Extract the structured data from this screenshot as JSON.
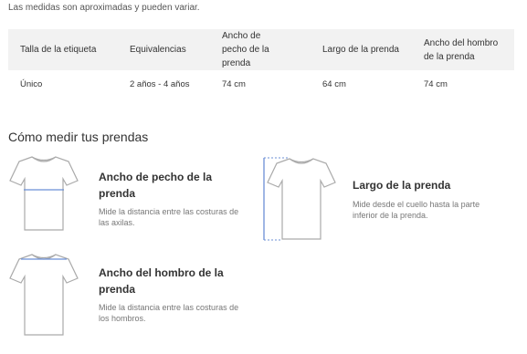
{
  "note": "Las medidas son aproximadas y pueden variar.",
  "table": {
    "headers": [
      "Talla de la etiqueta",
      "Equivalencias",
      "Ancho de pecho de la prenda",
      "Largo de la prenda",
      "Ancho del hombro de la prenda"
    ],
    "rows": [
      [
        "Único",
        "2 años - 4 años",
        "74 cm",
        "64 cm",
        "74 cm"
      ]
    ]
  },
  "how_to_measure": {
    "title": "Cómo medir tus prendas",
    "items": [
      {
        "title": "Ancho de pecho de la prenda",
        "description": "Mide la distancia entre las costuras de las axilas.",
        "icon": "shirt-chest-icon"
      },
      {
        "title": "Largo de la prenda",
        "description": "Mide desde el cuello hasta la parte inferior de la prenda.",
        "icon": "shirt-length-icon"
      },
      {
        "title": "Ancho del hombro de la prenda",
        "description": "Mide la distancia entre las costuras de los hombros.",
        "icon": "shirt-shoulder-icon"
      }
    ]
  },
  "colors": {
    "measure_line": "#6b8fd6",
    "header_bg": "#f2f2f2"
  }
}
